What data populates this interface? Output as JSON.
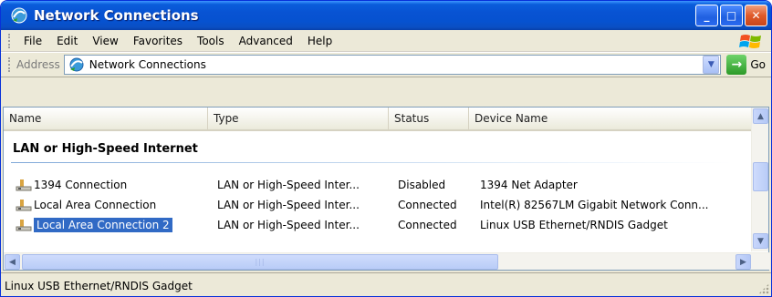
{
  "window": {
    "title": "Network Connections",
    "minimize_symbol": "_",
    "maximize_symbol": "□",
    "close_symbol": "✕"
  },
  "menu": {
    "items": [
      {
        "label": "File"
      },
      {
        "label": "Edit"
      },
      {
        "label": "View"
      },
      {
        "label": "Favorites"
      },
      {
        "label": "Tools"
      },
      {
        "label": "Advanced"
      },
      {
        "label": "Help"
      }
    ]
  },
  "address": {
    "label": "Address",
    "value": "Network Connections",
    "go_label": "Go"
  },
  "columns": [
    "Name",
    "Type",
    "Status",
    "Device Name"
  ],
  "group": {
    "title": "LAN or High-Speed Internet"
  },
  "rows": [
    {
      "name": "1394 Connection",
      "type": "LAN or High-Speed Inter...",
      "status": "Disabled",
      "device": "1394 Net Adapter"
    },
    {
      "name": "Local Area Connection",
      "type": "LAN or High-Speed Inter...",
      "status": "Connected",
      "device": "Intel(R) 82567LM Gigabit Network Conn..."
    },
    {
      "name": "Local Area Connection 2",
      "type": "LAN or High-Speed Inter...",
      "status": "Connected",
      "device": "Linux USB Ethernet/RNDIS Gadget"
    }
  ],
  "selected_row": 2,
  "statusbar": {
    "text": "Linux USB Ethernet/RNDIS Gadget"
  },
  "colors": {
    "titlebar": "#0a5ddb",
    "selection": "#316ac5",
    "chrome": "#ece9d8"
  }
}
